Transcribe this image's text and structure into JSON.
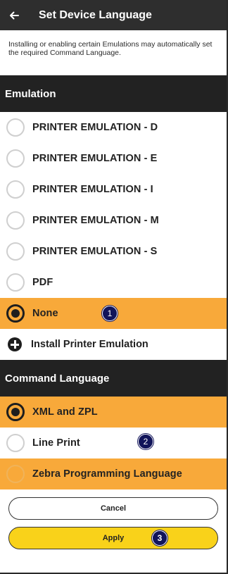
{
  "appbar": {
    "title": "Set Device Language",
    "back_icon": "arrow-left-icon"
  },
  "notice": "Installing or enabling certain Emulations may automatically set the required Command Language.",
  "emulation": {
    "header": "Emulation",
    "options": [
      {
        "label": "PRINTER EMULATION - D",
        "selected": false
      },
      {
        "label": "PRINTER EMULATION - E",
        "selected": false
      },
      {
        "label": "PRINTER EMULATION - I",
        "selected": false
      },
      {
        "label": "PRINTER EMULATION - M",
        "selected": false
      },
      {
        "label": "PRINTER EMULATION - S",
        "selected": false
      },
      {
        "label": "PDF",
        "selected": false
      },
      {
        "label": "None",
        "selected": true
      }
    ],
    "install_label": "Install Printer Emulation"
  },
  "command_language": {
    "header": "Command Language",
    "options": [
      {
        "label": "XML and ZPL",
        "selected": true
      },
      {
        "label": "Line Print",
        "selected": false
      },
      {
        "label": "Zebra Programming Language",
        "selected": false,
        "highlighted": true
      }
    ]
  },
  "buttons": {
    "cancel": "Cancel",
    "apply": "Apply"
  },
  "callouts": [
    "1",
    "2",
    "3"
  ],
  "colors": {
    "accent": "#f8a93a",
    "apply": "#f9d21a",
    "header": "#222222",
    "callout": "#11145a"
  }
}
